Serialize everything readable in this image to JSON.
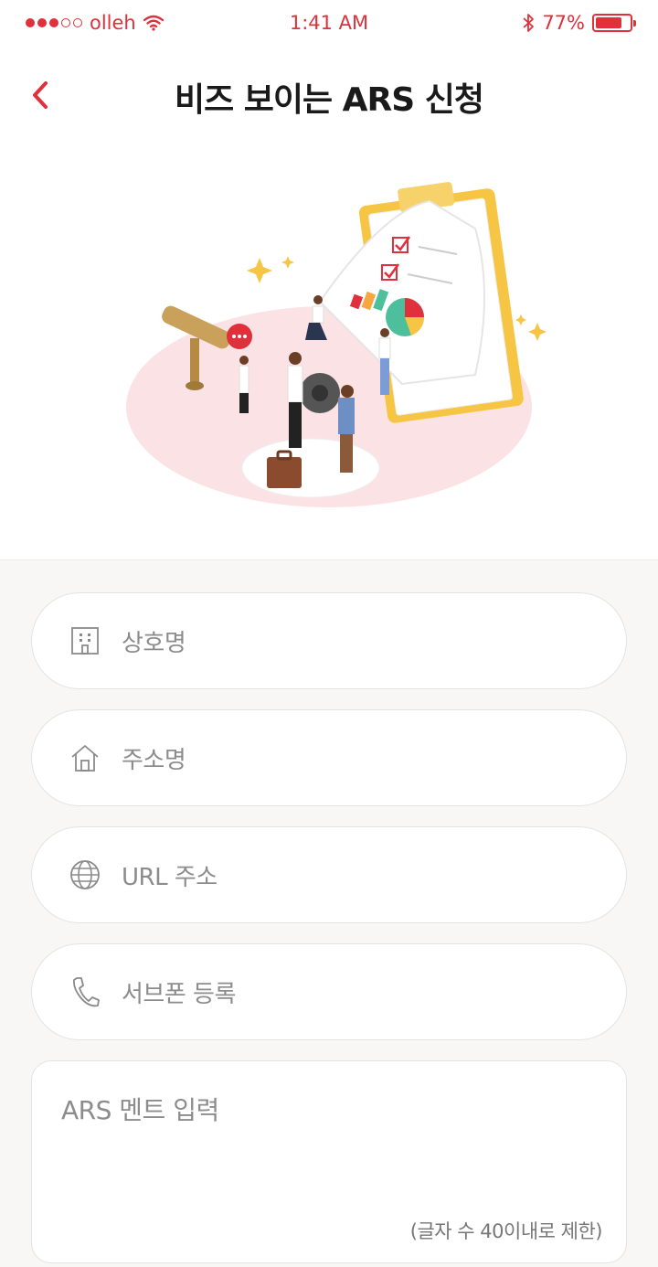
{
  "status_bar": {
    "carrier": "olleh",
    "time": "1:41 AM",
    "battery_percent": "77%",
    "battery_level": 0.77,
    "accent_color": "#e0303b"
  },
  "header": {
    "title": "비즈 보이는 ARS 신청",
    "back_icon": "chevron-left-icon"
  },
  "form": {
    "fields": [
      {
        "icon": "building-icon",
        "placeholder": "상호명"
      },
      {
        "icon": "home-icon",
        "placeholder": "주소명"
      },
      {
        "icon": "globe-icon",
        "placeholder": "URL 주소"
      },
      {
        "icon": "phone-icon",
        "placeholder": "서브폰 등록"
      }
    ],
    "ars_message": {
      "placeholder": "ARS 멘트 입력",
      "hint": "(글자 수 40이내로 제한)"
    }
  }
}
